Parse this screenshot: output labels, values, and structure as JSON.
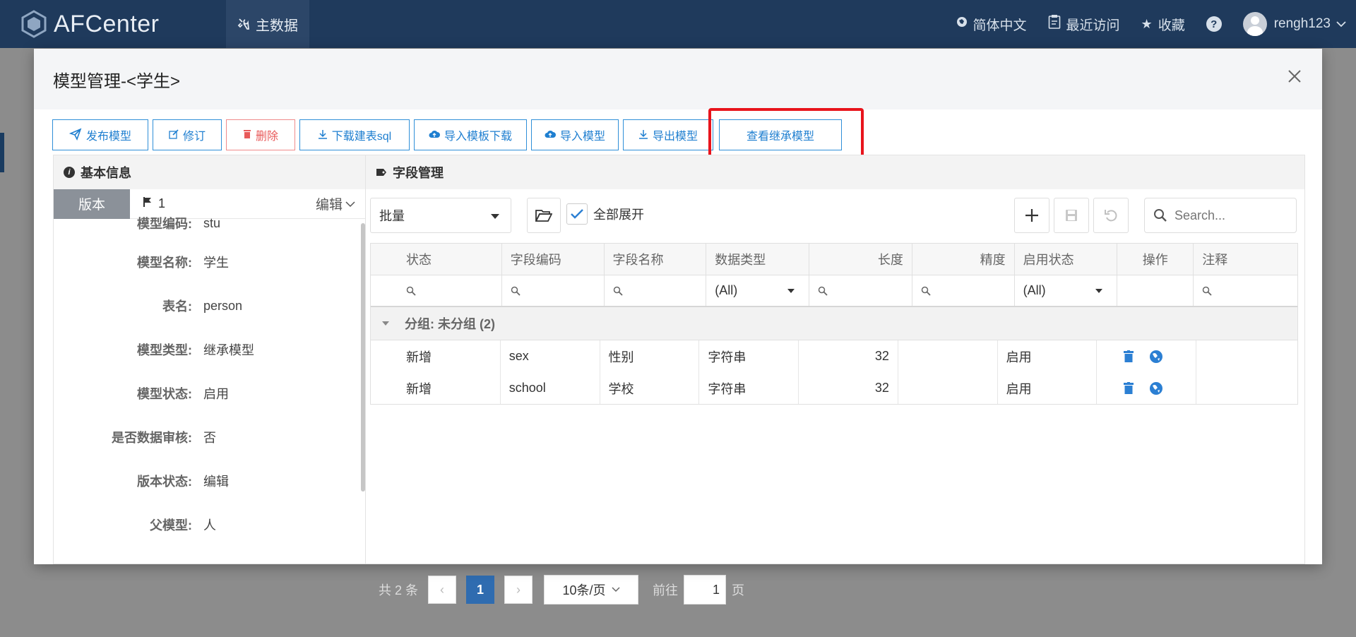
{
  "app": {
    "name": "AFCenter",
    "nav_main": "主数据"
  },
  "top_right": {
    "language": "简体中文",
    "recent": "最近访问",
    "favorites": "收藏",
    "username": "rengh123"
  },
  "pagination": {
    "total": "共 2 条",
    "current_page": "1",
    "page_size": "10条/页",
    "goto_label": "前往",
    "goto_value": "1",
    "page_suffix": "页"
  },
  "modal": {
    "title": "模型管理-<学生>",
    "toolbar": {
      "publish": "发布模型",
      "revise": "修订",
      "delete": "删除",
      "download_sql": "下载建表sql",
      "import_template_download": "导入模板下载",
      "import_model": "导入模型",
      "export_model": "导出模型",
      "view_inherit": "查看继承模型"
    },
    "basic_info": {
      "title": "基本信息",
      "version_label": "版本",
      "version_number": "1",
      "edit_label": "编辑",
      "fields": [
        {
          "label": "模型编码:",
          "value": "stu"
        },
        {
          "label": "模型名称:",
          "value": "学生"
        },
        {
          "label": "表名:",
          "value": "person"
        },
        {
          "label": "模型类型:",
          "value": "继承模型"
        },
        {
          "label": "模型状态:",
          "value": "启用"
        },
        {
          "label": "是否数据审核:",
          "value": "否"
        },
        {
          "label": "版本状态:",
          "value": "编辑"
        },
        {
          "label": "父模型:",
          "value": "人"
        }
      ]
    },
    "field_mgmt": {
      "title": "字段管理",
      "batch_select": "批量",
      "expand_all": "全部展开",
      "search_placeholder": "Search...",
      "columns": [
        "状态",
        "字段编码",
        "字段名称",
        "数据类型",
        "长度",
        "精度",
        "启用状态",
        "操作",
        "注释"
      ],
      "filter_all": "(All)",
      "group_label": "分组: 未分组 (2)",
      "rows": [
        {
          "status": "新增",
          "code": "sex",
          "name": "性别",
          "type": "字符串",
          "length": "32",
          "precision": "",
          "enabled": "启用",
          "comment": ""
        },
        {
          "status": "新增",
          "code": "school",
          "name": "学校",
          "type": "字符串",
          "length": "32",
          "precision": "",
          "enabled": "启用",
          "comment": ""
        }
      ]
    }
  },
  "colors": {
    "topbar": "#1f3a5c",
    "accent": "#1f7fd0",
    "danger": "#e85a5a",
    "highlight": "#e8141c"
  }
}
